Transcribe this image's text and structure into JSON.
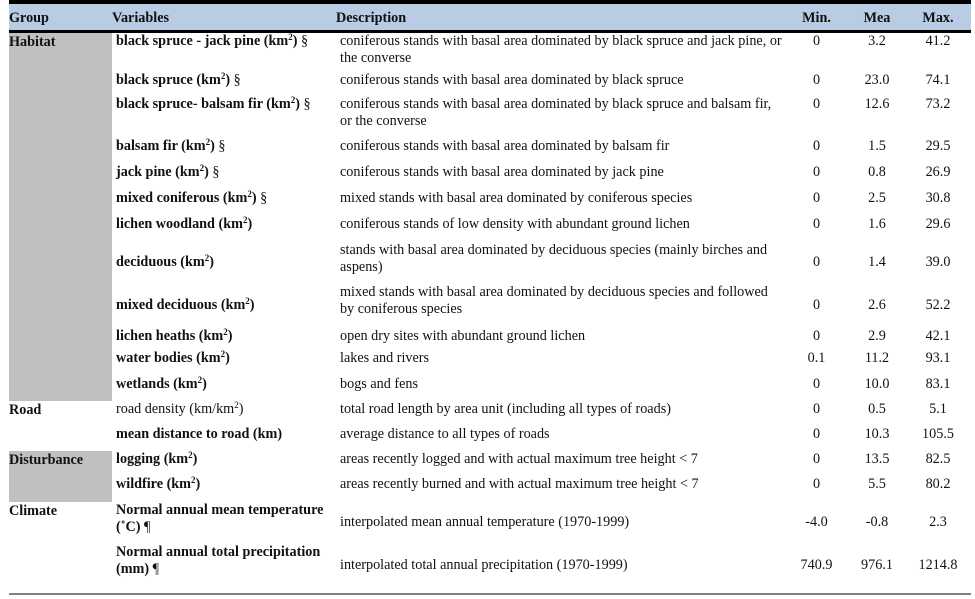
{
  "table": {
    "headers": {
      "group": "Group",
      "variables": "Variables",
      "description": "Description",
      "min": "Min.",
      "mean": "Mea",
      "max": "Max."
    },
    "groups": {
      "habitat": "Habitat",
      "road": "Road",
      "disturbance": "Disturbance",
      "climate": "Climate"
    },
    "rows": [
      {
        "group": "Habitat",
        "var_name": "black spruce - jack pine (km",
        "unit_sup": "2",
        "var_suffix": ")",
        "mark": " §",
        "description": "coniferous stands with basal area dominated by black spruce and jack pine, or the converse",
        "min": "0",
        "mean": "3.2",
        "max": "41.2"
      },
      {
        "group": "Habitat",
        "var_name": "black spruce (km",
        "unit_sup": "2",
        "var_suffix": ")",
        "mark": " §",
        "description": "coniferous stands with basal area dominated by black spruce",
        "min": "0",
        "mean": "23.0",
        "max": "74.1"
      },
      {
        "group": "Habitat",
        "var_name": "black spruce- balsam fir (km",
        "unit_sup": "2",
        "var_suffix": ")",
        "mark": " §",
        "description": "coniferous stands with basal area dominated by black spruce and balsam fir, or the converse",
        "min": "0",
        "mean": "12.6",
        "max": "73.2"
      },
      {
        "group": "Habitat",
        "var_name": "balsam fir (km",
        "unit_sup": "2",
        "var_suffix": ")",
        "mark": " §",
        "description": "coniferous stands with basal area dominated by balsam fir",
        "min": "0",
        "mean": "1.5",
        "max": "29.5"
      },
      {
        "group": "Habitat",
        "var_name": "jack pine (km",
        "unit_sup": "2",
        "var_suffix": ")",
        "mark": " §",
        "description": "coniferous stands with basal area dominated by jack pine",
        "min": "0",
        "mean": "0.8",
        "max": "26.9"
      },
      {
        "group": "Habitat",
        "var_name": "mixed coniferous (km",
        "unit_sup": "2",
        "var_suffix": ")",
        "mark": " §",
        "description": "mixed stands with basal area dominated by coniferous species",
        "min": "0",
        "mean": "2.5",
        "max": "30.8"
      },
      {
        "group": "Habitat",
        "var_name": "lichen woodland (km",
        "unit_sup": "2",
        "var_suffix": ")",
        "mark": "",
        "description": "coniferous stands of low density with abundant ground lichen",
        "min": "0",
        "mean": "1.6",
        "max": "29.6"
      },
      {
        "group": "Habitat",
        "var_name": "deciduous (km",
        "unit_sup": "2",
        "var_suffix": ")",
        "mark": "",
        "description": "stands with basal area dominated by deciduous species (mainly birches and aspens)",
        "min": "0",
        "mean": "1.4",
        "max": "39.0"
      },
      {
        "group": "Habitat",
        "var_name": "mixed deciduous (km",
        "unit_sup": "2",
        "var_suffix": ")",
        "mark": "",
        "description": "mixed stands with basal area dominated by deciduous species and followed by coniferous species",
        "min": "0",
        "mean": "2.6",
        "max": "52.2"
      },
      {
        "group": "Habitat",
        "var_name": "lichen heaths (km",
        "unit_sup": "2",
        "var_suffix": ")",
        "mark": "",
        "description": "open dry sites with abundant ground lichen",
        "min": "0",
        "mean": "2.9",
        "max": "42.1"
      },
      {
        "group": "Habitat",
        "var_name": "water bodies (km",
        "unit_sup": "2",
        "var_suffix": ")",
        "mark": "",
        "description": "lakes and rivers",
        "min": "0.1",
        "mean": "11.2",
        "max": "93.1"
      },
      {
        "group": "Habitat",
        "var_name": "wetlands (km",
        "unit_sup": "2",
        "var_suffix": ")",
        "mark": "",
        "description": "bogs and fens",
        "min": "0",
        "mean": "10.0",
        "max": "83.1"
      },
      {
        "group": "Road",
        "var_name": "road density (km/km",
        "unit_sup": "2",
        "var_suffix": ")",
        "mark": "",
        "description": "total road length by area unit (including all types of roads)",
        "min": "0",
        "mean": "0.5",
        "max": "5.1"
      },
      {
        "group": "Road",
        "var_name": "mean distance to road (km)",
        "unit_sup": "",
        "var_suffix": "",
        "mark": "",
        "description": "average distance to all types of roads",
        "min": "0",
        "mean": "10.3",
        "max": "105.5"
      },
      {
        "group": "Disturbance",
        "var_name": "logging (km",
        "unit_sup": "2",
        "var_suffix": ")",
        "mark": "",
        "description": "areas recently logged and with actual maximum tree height < 7",
        "min": "0",
        "mean": "13.5",
        "max": "82.5"
      },
      {
        "group": "Disturbance",
        "var_name": "wildfire (km",
        "unit_sup": "2",
        "var_suffix": ")",
        "mark": "",
        "description": "areas recently burned and with actual maximum tree height < 7",
        "min": "0",
        "mean": "5.5",
        "max": "80.2"
      },
      {
        "group": "Climate",
        "var_name": "Normal annual mean temperature (˚C)",
        "unit_sup": "",
        "var_suffix": "",
        "mark": " ¶",
        "description": "interpolated mean annual temperature (1970-1999)",
        "min": "-4.0",
        "mean": "-0.8",
        "max": "2.3"
      },
      {
        "group": "Climate",
        "var_name": "Normal annual total precipitation (mm)",
        "unit_sup": "",
        "var_suffix": "",
        "mark": " ¶",
        "description": "interpolated total annual precipitation (1970-1999)",
        "min": "740.9",
        "mean": "976.1",
        "max": "1214.8"
      }
    ]
  }
}
